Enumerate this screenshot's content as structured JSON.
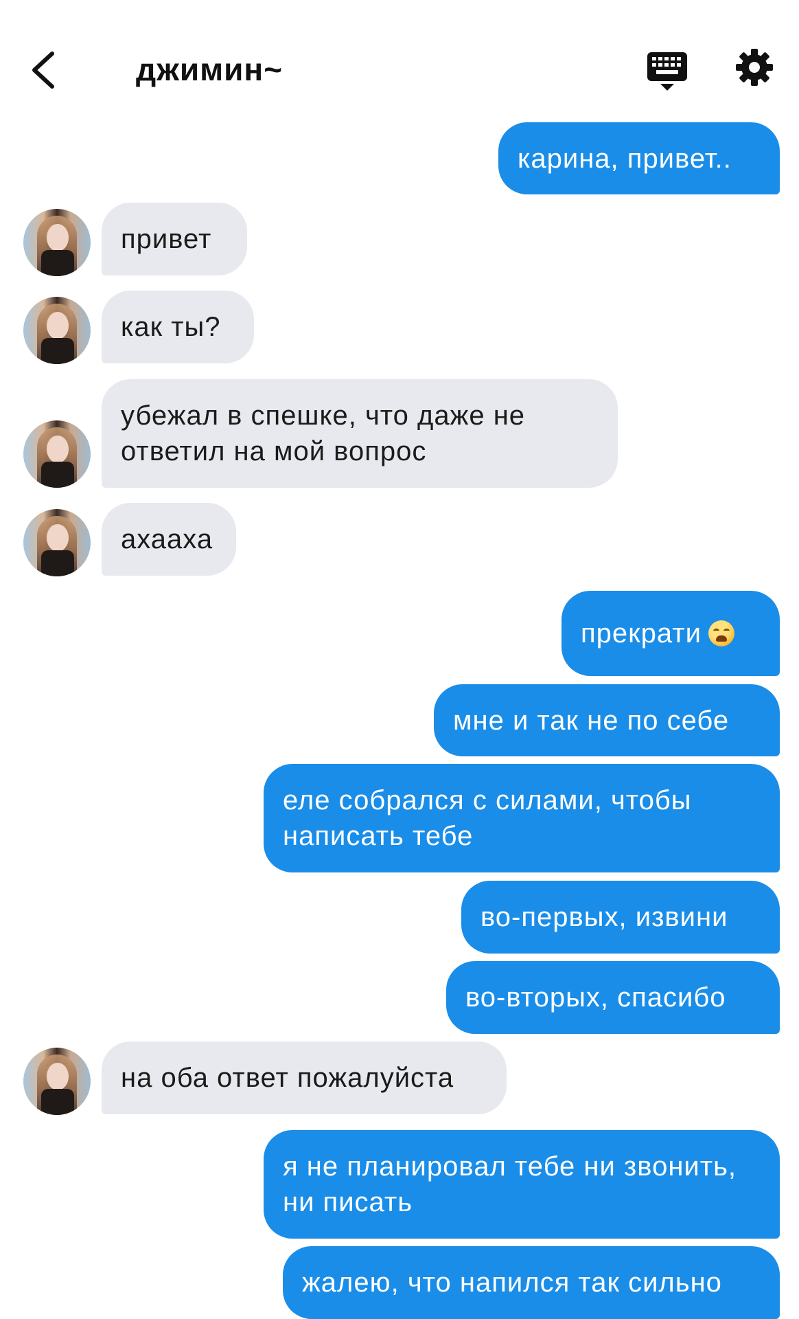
{
  "header": {
    "title": "джимин~",
    "back_icon": "chevron-left-icon",
    "keyboard_icon": "keyboard-icon",
    "settings_icon": "gear-icon"
  },
  "colors": {
    "outgoing_bubble": "#1a8de9",
    "incoming_bubble": "#e8e9ee",
    "background": "#ffffff"
  },
  "messages": [
    {
      "side": "out",
      "text": "карина, привет.."
    },
    {
      "side": "in",
      "text": "привет"
    },
    {
      "side": "in",
      "text": "как ты?"
    },
    {
      "side": "in",
      "text": "убежал в спешке, что даже не ответил на мой вопрос"
    },
    {
      "side": "in",
      "text": "ахааха"
    },
    {
      "side": "out",
      "text": "прекрати",
      "emoji": "weary-face-emoji"
    },
    {
      "side": "out",
      "text": "мне и так не по себе"
    },
    {
      "side": "out",
      "text": "еле собрался с силами, чтобы написать тебе"
    },
    {
      "side": "out",
      "text": "во-первых, извини"
    },
    {
      "side": "out",
      "text": "во-вторых, спасибо"
    },
    {
      "side": "in",
      "text": "на оба ответ пожалуйста"
    },
    {
      "side": "out",
      "text": "я не планировал тебе ни звонить, ни писать"
    },
    {
      "side": "out",
      "text": "жалею, что напился так сильно"
    }
  ]
}
